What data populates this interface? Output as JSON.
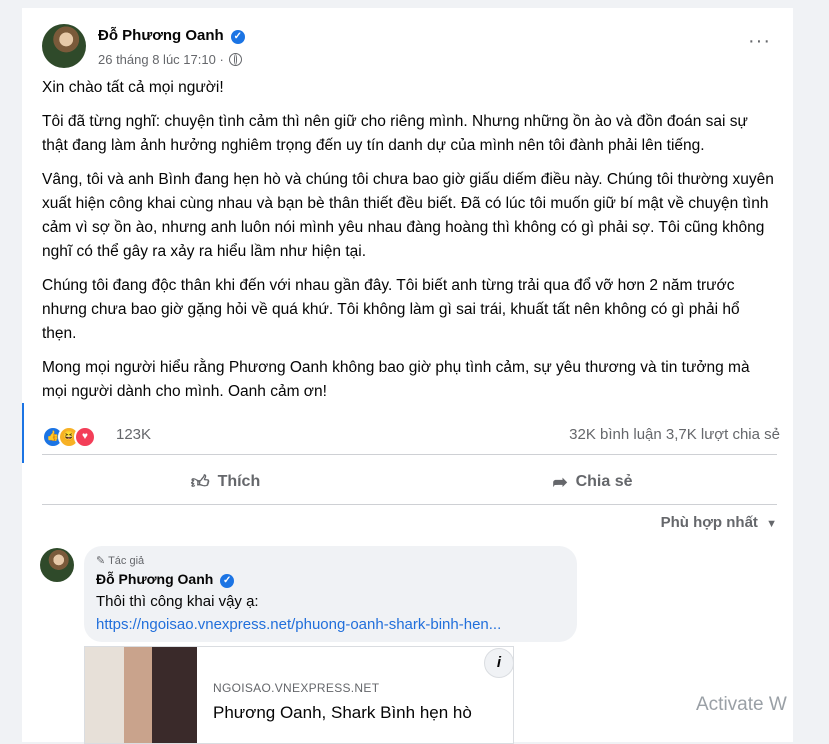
{
  "post": {
    "author": "Đỗ Phương Oanh",
    "timestamp": "26 tháng 8 lúc 17:10",
    "paragraphs": [
      "Xin chào tất cả mọi người!",
      "Tôi đã từng nghĩ: chuyện tình cảm thì nên giữ cho riêng mình. Nhưng những ồn ào và đồn đoán sai sự thật đang làm ảnh hưởng nghiêm trọng đến uy tín danh dự của mình nên tôi đành phải lên tiếng.",
      "Vâng, tôi và anh Bình đang hẹn hò và chúng tôi chưa bao giờ giấu diếm điều này. Chúng tôi thường xuyên xuất hiện công khai cùng nhau và bạn bè thân thiết đều biết. Đã có lúc tôi muốn giữ bí mật về chuyện tình cảm vì sợ ồn ào, nhưng anh luôn nói mình yêu nhau đàng hoàng thì không có gì phải sợ. Tôi cũng không nghĩ có thể gây ra xảy ra hiểu lầm như hiện tại.",
      "Chúng tôi đang độc thân khi đến với nhau gần đây. Tôi biết anh từng trải qua đổ vỡ hơn 2 năm trước nhưng chưa bao giờ gặng hỏi về quá khứ. Tôi không làm gì sai trái, khuất tất nên không có gì phải hổ thẹn.",
      " Mong mọi người hiểu rằng Phương Oanh không bao giờ phụ tình cảm, sự yêu thương và tin tưởng mà mọi người dành cho mình. Oanh cảm ơn!"
    ],
    "reaction_count": "123K",
    "comments_count": "32K bình luận",
    "shares_count": "3,7K lượt chia sẻ"
  },
  "actions": {
    "like_label": "Thích",
    "share_label": "Chia sẻ"
  },
  "sort_label": "Phù hợp nhất",
  "comment": {
    "badge": "Tác giả",
    "author": "Đỗ Phương Oanh",
    "text": "Thôi thì công khai vậy ạ:",
    "link": "https://ngoisao.vnexpress.net/phuong-oanh-shark-binh-hen..."
  },
  "link_preview": {
    "domain": "NGOISAO.VNEXPRESS.NET",
    "title": "Phương Oanh, Shark Bình hẹn hò"
  },
  "watermark": "Activate W",
  "icons": {
    "verified": "verified-badge-icon",
    "privacy": "globe-icon",
    "more": "more-dots-icon",
    "like": "thumbs-up-icon",
    "share": "share-arrow-icon",
    "sort": "caret-down-icon",
    "info": "info-icon",
    "author_badge": "pencil-icon"
  },
  "colors": {
    "accent": "#1b74e4",
    "link": "#216fdb",
    "secondary_text": "#65676b"
  }
}
